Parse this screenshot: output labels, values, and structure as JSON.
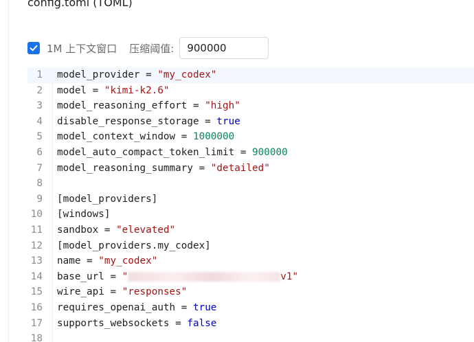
{
  "file_title": "config.toml (TOML)",
  "toolbar": {
    "context_checkbox_checked": true,
    "context_checkbox_label": "1M 上下文窗口",
    "threshold_label": "压缩阈值:",
    "threshold_value": "900000"
  },
  "editor": {
    "active_line": 1,
    "lines": [
      {
        "num": "1",
        "tokens": [
          {
            "t": "model_provider = ",
            "k": "plain"
          },
          {
            "t": "\"my_codex\"",
            "k": "str"
          }
        ]
      },
      {
        "num": "2",
        "tokens": [
          {
            "t": "model = ",
            "k": "plain"
          },
          {
            "t": "\"kimi-k2.6\"",
            "k": "str"
          }
        ]
      },
      {
        "num": "3",
        "tokens": [
          {
            "t": "model_reasoning_effort = ",
            "k": "plain"
          },
          {
            "t": "\"high\"",
            "k": "str"
          }
        ]
      },
      {
        "num": "4",
        "tokens": [
          {
            "t": "disable_response_storage = ",
            "k": "plain"
          },
          {
            "t": "true",
            "k": "kw"
          }
        ]
      },
      {
        "num": "5",
        "tokens": [
          {
            "t": "model_context_window = ",
            "k": "plain"
          },
          {
            "t": "1000000",
            "k": "num"
          }
        ]
      },
      {
        "num": "6",
        "tokens": [
          {
            "t": "model_auto_compact_token_limit = ",
            "k": "plain"
          },
          {
            "t": "900000",
            "k": "num"
          }
        ]
      },
      {
        "num": "7",
        "tokens": [
          {
            "t": "model_reasoning_summary = ",
            "k": "plain"
          },
          {
            "t": "\"detailed\"",
            "k": "str"
          }
        ]
      },
      {
        "num": "8",
        "tokens": []
      },
      {
        "num": "9",
        "tokens": [
          {
            "t": "[model_providers]",
            "k": "plain"
          }
        ]
      },
      {
        "num": "10",
        "tokens": [
          {
            "t": "[windows]",
            "k": "plain"
          }
        ]
      },
      {
        "num": "11",
        "tokens": [
          {
            "t": "sandbox = ",
            "k": "plain"
          },
          {
            "t": "\"elevated\"",
            "k": "str"
          }
        ]
      },
      {
        "num": "12",
        "tokens": [
          {
            "t": "[model_providers.my_codex]",
            "k": "plain"
          }
        ]
      },
      {
        "num": "13",
        "tokens": [
          {
            "t": "name = ",
            "k": "plain"
          },
          {
            "t": "\"my_codex\"",
            "k": "str"
          }
        ]
      },
      {
        "num": "14",
        "tokens": [
          {
            "t": "base_url = ",
            "k": "plain"
          },
          {
            "t": "\"",
            "k": "str"
          },
          {
            "t": "",
            "k": "redacted"
          },
          {
            "t": "v1\"",
            "k": "str"
          }
        ]
      },
      {
        "num": "15",
        "tokens": [
          {
            "t": "wire_api = ",
            "k": "plain"
          },
          {
            "t": "\"responses\"",
            "k": "str"
          }
        ]
      },
      {
        "num": "16",
        "tokens": [
          {
            "t": "requires_openai_auth = ",
            "k": "plain"
          },
          {
            "t": "true",
            "k": "kw"
          }
        ]
      },
      {
        "num": "17",
        "tokens": [
          {
            "t": "supports_websockets = ",
            "k": "plain"
          },
          {
            "t": "false",
            "k": "kw"
          }
        ]
      },
      {
        "num": "18",
        "tokens": []
      }
    ]
  }
}
